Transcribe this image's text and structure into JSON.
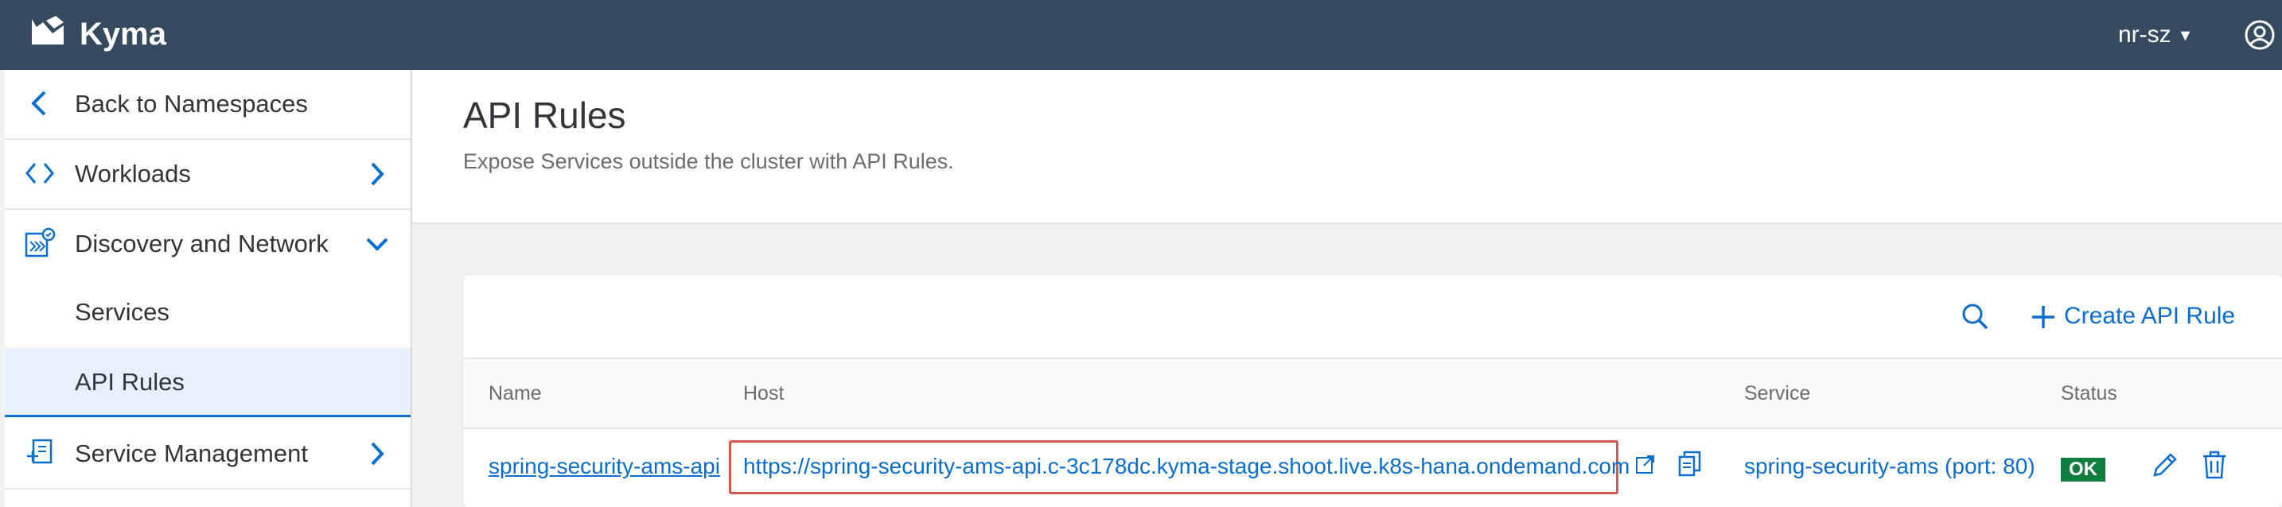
{
  "shell": {
    "brand": "Kyma",
    "namespace": "nr-sz",
    "colors": {
      "shellbar": "#354a5f",
      "accent": "#0a6ed1",
      "status_ok": "#107e3e",
      "highlight": "#d9534f"
    }
  },
  "sidebar": {
    "back_label": "Back to Namespaces",
    "items": [
      {
        "label": "Workloads",
        "icon": "code-icon",
        "state": "collapsed"
      },
      {
        "label": "Discovery and Network",
        "icon": "network-icon",
        "state": "expanded"
      },
      {
        "label": "Service Management",
        "icon": "service-icon",
        "state": "collapsed"
      }
    ],
    "sub_items": [
      {
        "label": "Services"
      },
      {
        "label": "API Rules",
        "selected": true
      }
    ]
  },
  "page": {
    "title": "API Rules",
    "description": "Expose Services outside the cluster with API Rules."
  },
  "toolbar": {
    "create_label": "Create API Rule"
  },
  "table": {
    "columns": [
      "Name",
      "Host",
      "Service",
      "Status"
    ],
    "rows": [
      {
        "name": "spring-security-ams-api",
        "host": "https://spring-security-ams-api.c-3c178dc.kyma-stage.shoot.live.k8s-hana.ondemand.com",
        "service": "spring-security-ams (port: 80)",
        "status": "OK"
      }
    ]
  }
}
